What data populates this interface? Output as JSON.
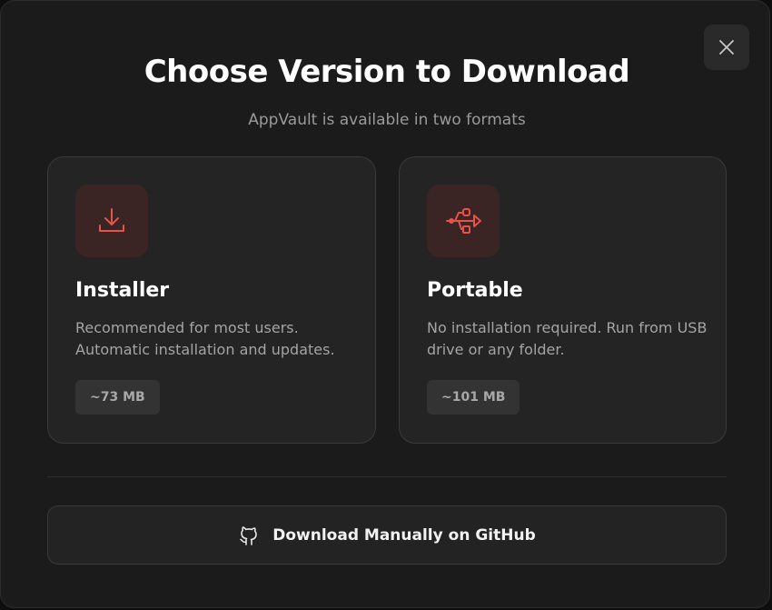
{
  "dialog": {
    "title": "Choose Version to Download",
    "subtitle": "AppVault is available in two formats",
    "close_icon": "close-icon"
  },
  "options": [
    {
      "id": "installer",
      "icon": "download-icon",
      "title": "Installer",
      "description": "Recommended for most users. Automatic installation and updates.",
      "size": "~73 MB"
    },
    {
      "id": "portable",
      "icon": "usb-icon",
      "title": "Portable",
      "description": "No installation required. Run from USB drive or any folder.",
      "size": "~101 MB"
    }
  ],
  "github": {
    "icon": "github-icon",
    "label": "Download Manually on GitHub"
  },
  "colors": {
    "accent": "#e5534b",
    "background": "#1b1b1b",
    "card": "#242424"
  }
}
